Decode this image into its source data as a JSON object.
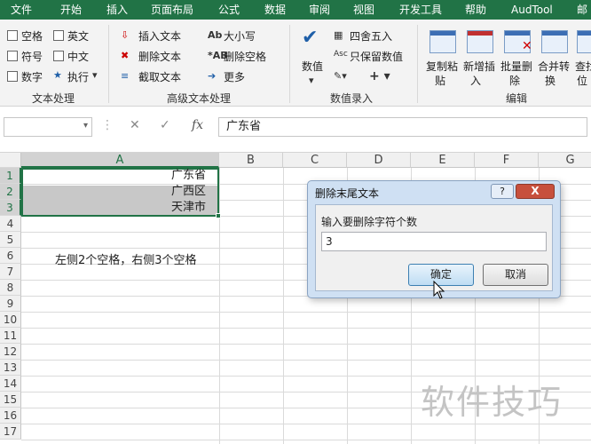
{
  "ribbon_tabs": [
    "文件",
    "开始",
    "插入",
    "页面布局",
    "公式",
    "数据",
    "审阅",
    "视图",
    "开发工具",
    "帮助",
    "AudTool",
    "邮"
  ],
  "groups": {
    "text_processing": {
      "label": "文本处理",
      "checkboxes": [
        "空格",
        "英文",
        "符号",
        "中文",
        "数字"
      ],
      "execute": "执行"
    },
    "advanced": {
      "label": "高级文本处理",
      "items": [
        "插入文本",
        "删除文本",
        "截取文本"
      ],
      "items2": [
        "大小写",
        "删除空格",
        "更多"
      ]
    },
    "number_entry": {
      "label": "数值录入",
      "number_button": "数值",
      "items": [
        "四舍五入",
        "只保留数值"
      ]
    },
    "edit": {
      "label": "编辑",
      "buttons": [
        {
          "line1": "复制粘",
          "line2": "贴"
        },
        {
          "line1": "新增插",
          "line2": "入"
        },
        {
          "line1": "批量删",
          "line2": "除"
        },
        {
          "line1": "合并转",
          "line2": "换"
        },
        {
          "line1": "查找",
          "line2": "位"
        }
      ]
    }
  },
  "formula_bar": {
    "fx": "fx",
    "value": "广东省"
  },
  "columns": [
    "A",
    "B",
    "C",
    "D",
    "E",
    "F",
    "G"
  ],
  "rows": [
    "1",
    "2",
    "3",
    "4",
    "5",
    "6",
    "7",
    "8",
    "9",
    "10",
    "11",
    "12",
    "13",
    "14",
    "15",
    "16",
    "17"
  ],
  "cells": {
    "A1": "广东省",
    "A2": "广西区",
    "A3": "天津市",
    "A6": "左侧2个空格，右侧3个空格"
  },
  "dialog": {
    "title": "删除末尾文本",
    "help": "?",
    "close": "X",
    "label": "输入要删除字符个数",
    "input_value": "3",
    "ok": "确定",
    "cancel": "取消"
  },
  "watermark": "软件技巧"
}
